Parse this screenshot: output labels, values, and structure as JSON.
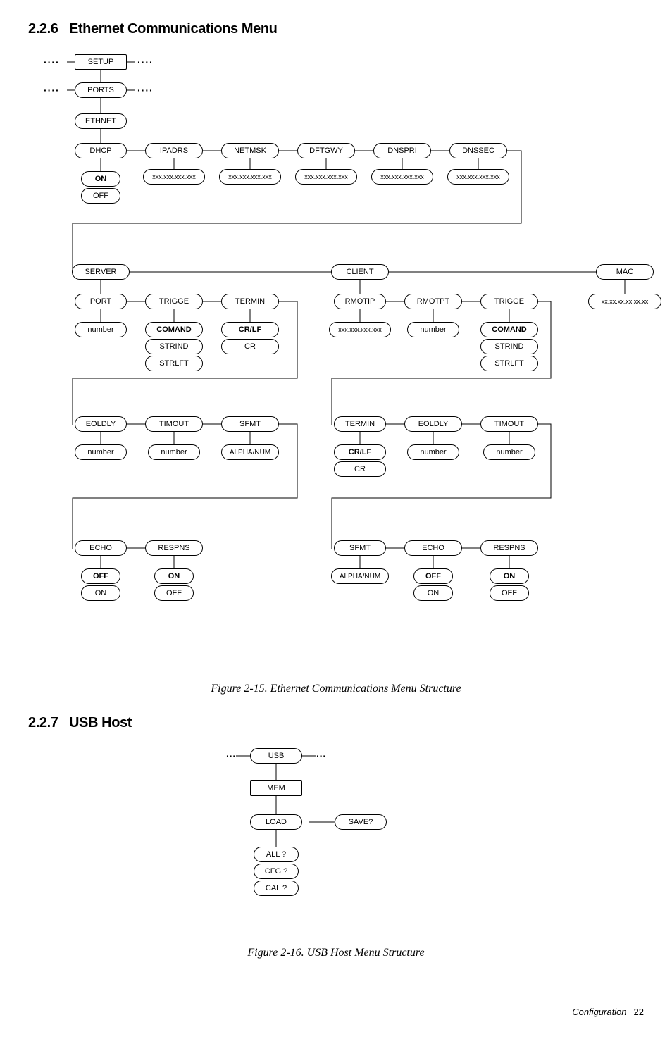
{
  "section1": {
    "number": "2.2.6",
    "title": "Ethernet Communications Menu"
  },
  "section2": {
    "number": "2.2.7",
    "title": "USB Host"
  },
  "fig1_caption": "Figure 2-15. Ethernet Communications Menu Structure",
  "fig2_caption": "Figure 2-16. USB Host Menu Structure",
  "footer_section": "Configuration",
  "footer_page": "22",
  "d1": {
    "setup": "SETUP",
    "ports": "PORTS",
    "ethnet": "ETHNET",
    "dhcp": "DHCP",
    "ipadrs": "IPADRS",
    "netmsk": "NETMSK",
    "dftgwy": "DFTGWY",
    "dnspri": "DNSPRI",
    "dnssec": "DNSSEC",
    "on": "ON",
    "off": "OFF",
    "ip": "xxx.xxx.xxx.xxx",
    "server": "SERVER",
    "client": "CLIENT",
    "mac": "MAC",
    "macval": "xx.xx.xx.xx.xx.xx",
    "port": "PORT",
    "trigge": "TRIGGE",
    "termin": "TERMIN",
    "rmotip": "RMOTIP",
    "rmotpt": "RMOTPT",
    "number": "number",
    "comand": "COMAND",
    "crlf": "CR/LF",
    "cr": "CR",
    "strind": "STRIND",
    "strlft": "STRLFT",
    "eoldly": "EOLDLY",
    "timout": "TIMOUT",
    "sfmt": "SFMT",
    "alphanum": "ALPHA/NUM",
    "echo": "ECHO",
    "respns": "RESPNS"
  },
  "d2": {
    "usb": "USB",
    "mem": "MEM",
    "load": "LOAD",
    "save": "SAVE?",
    "all": "ALL ?",
    "cfg": "CFG ?",
    "cal": "CAL ?"
  }
}
